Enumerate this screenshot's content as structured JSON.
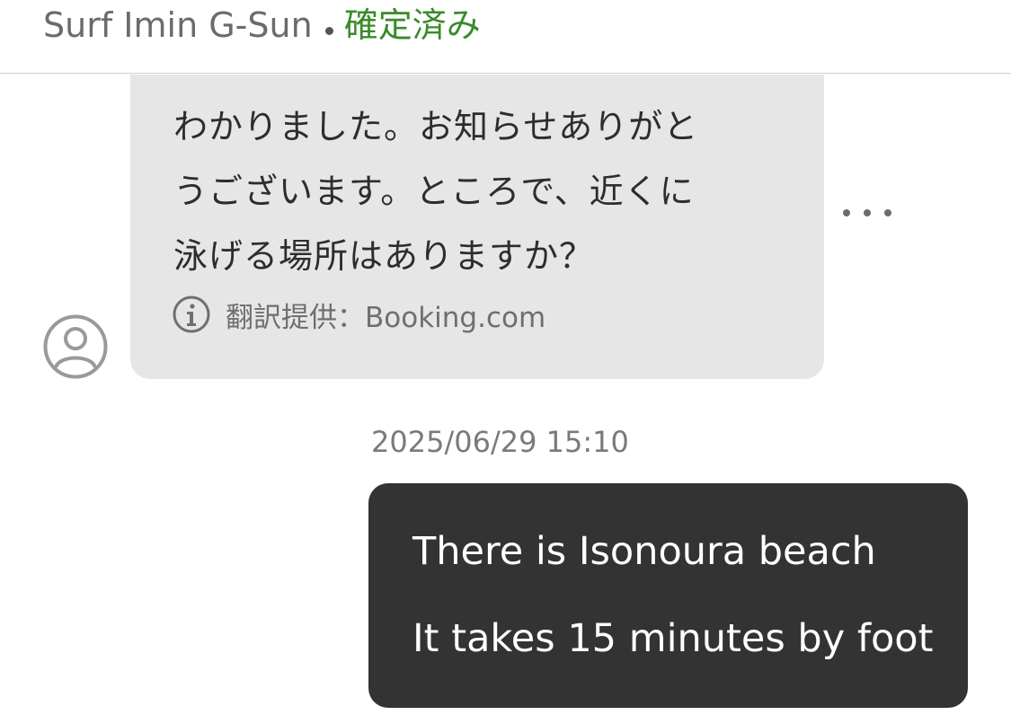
{
  "header": {
    "property_name": "Surf Imin G-Sun",
    "status": "確定済み",
    "status_color": "#3a8a2a"
  },
  "incoming_message": {
    "lines": [
      "わかりました。お知らせありがと",
      "うございます。ところで、近くに",
      "泳げる場所はありますか？"
    ],
    "translation_note": "翻訳提供：Booking.com",
    "translation_icon": "info-icon",
    "avatar_icon": "user-avatar-icon",
    "more_icon": "more-options-icon",
    "bubble_color": "#e6e6e6"
  },
  "timestamp": "2025/06/29 15:10",
  "outgoing_message": {
    "lines": [
      "There is Isonoura beach",
      "It takes 15 minutes by foot"
    ],
    "bubble_color": "#333333"
  }
}
